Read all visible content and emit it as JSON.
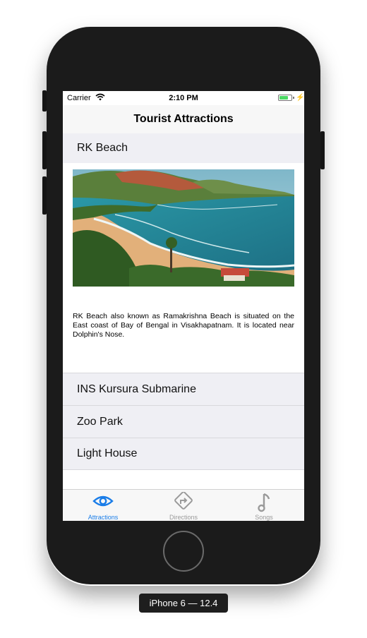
{
  "status_bar": {
    "carrier": "Carrier",
    "time": "2:10 PM"
  },
  "nav": {
    "title": "Tourist Attractions"
  },
  "sections": [
    {
      "title": "RK Beach",
      "expanded": true,
      "description": "RK Beach also known as Ramakrishna Beach is situated on the East coast of Bay of Bengal in Visakhapatnam. It is located near Dolphin's Nose."
    },
    {
      "title": "INS Kursura Submarine",
      "expanded": false
    },
    {
      "title": "Zoo Park",
      "expanded": false
    },
    {
      "title": "Light House",
      "expanded": false
    }
  ],
  "tabs": [
    {
      "label": "Attractions",
      "icon": "eye-icon",
      "selected": true
    },
    {
      "label": "Directions",
      "icon": "directions-icon",
      "selected": false
    },
    {
      "label": "Songs",
      "icon": "music-note-icon",
      "selected": false
    }
  ],
  "device": {
    "label": "iPhone 6 — 12.4"
  },
  "colors": {
    "accent": "#1a7de8",
    "inactive": "#9a9a9a",
    "row_background": "#efeff4"
  }
}
